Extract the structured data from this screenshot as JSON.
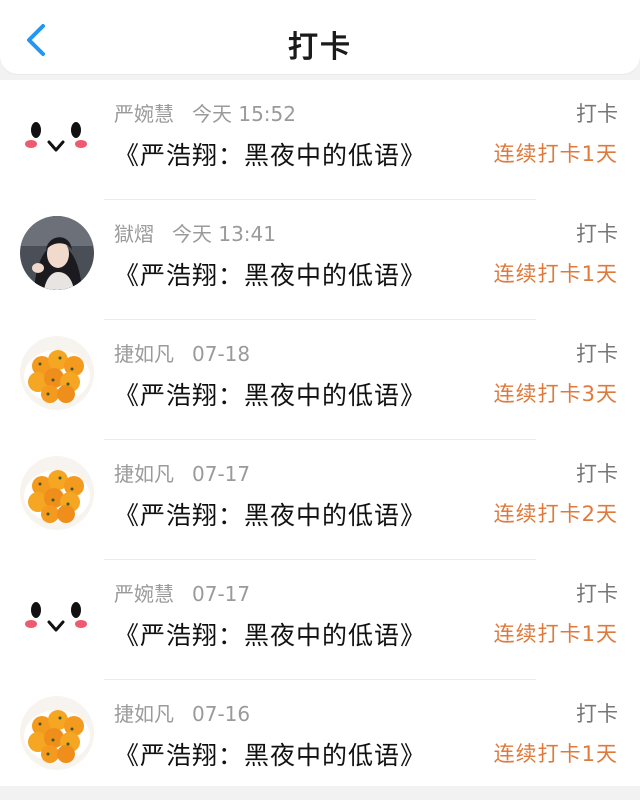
{
  "header": {
    "title": "打卡"
  },
  "rows": [
    {
      "avatar": "emoji-face-avatar",
      "name": "严婉慧",
      "time": "今天 15:52",
      "book": "《严浩翔：黑夜中的低语》",
      "action": "打卡",
      "streak": "连续打卡1天"
    },
    {
      "avatar": "photo-avatar",
      "name": "獄熠",
      "time": "今天 13:41",
      "book": "《严浩翔：黑夜中的低语》",
      "action": "打卡",
      "streak": "连续打卡1天"
    },
    {
      "avatar": "food-avatar",
      "name": "捷如凡",
      "time": "07-18",
      "book": "《严浩翔：黑夜中的低语》",
      "action": "打卡",
      "streak": "连续打卡3天"
    },
    {
      "avatar": "food-avatar",
      "name": "捷如凡",
      "time": "07-17",
      "book": "《严浩翔：黑夜中的低语》",
      "action": "打卡",
      "streak": "连续打卡2天"
    },
    {
      "avatar": "emoji-face-avatar",
      "name": "严婉慧",
      "time": "07-17",
      "book": "《严浩翔：黑夜中的低语》",
      "action": "打卡",
      "streak": "连续打卡1天"
    },
    {
      "avatar": "food-avatar",
      "name": "捷如凡",
      "time": "07-16",
      "book": "《严浩翔：黑夜中的低语》",
      "action": "打卡",
      "streak": "连续打卡1天"
    }
  ],
  "colors": {
    "accent_back": "#2196f3",
    "streak": "#e07a3c",
    "meta": "#9a9a9a"
  }
}
